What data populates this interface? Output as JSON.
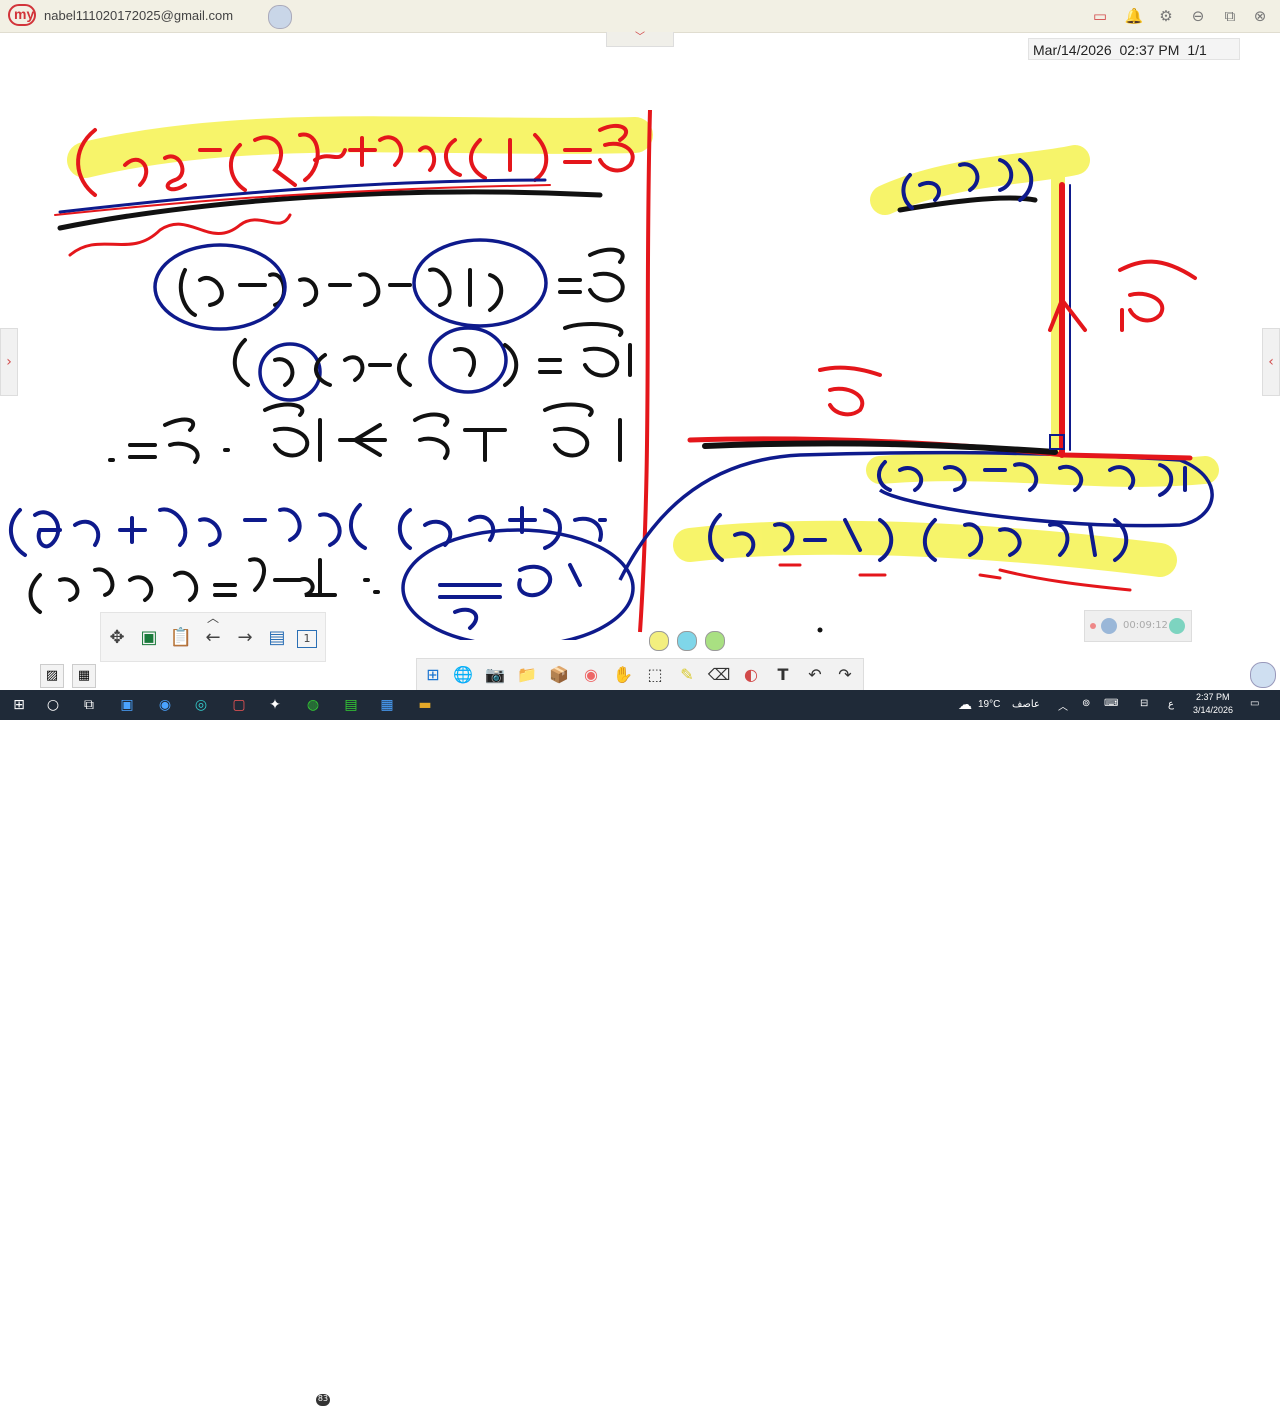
{
  "app": {
    "email": "nabel111020172025@gmail.com"
  },
  "topbar": {
    "icons": [
      "cast-icon",
      "bell-icon",
      "gear-icon",
      "minimize-icon",
      "restore-icon",
      "close-icon"
    ]
  },
  "header": {
    "date": "Mar/14/2026",
    "time": "02:37 PM",
    "page": "1/1"
  },
  "colors": {
    "ink_red": "#e4161b",
    "ink_blue": "#0e1a8c",
    "ink_black": "#111111",
    "highlight": "#f6f35a",
    "pen_yellow": "#f3ef7f",
    "pen_cyan": "#7fd6e9",
    "pen_green": "#a9e082"
  },
  "recorder": {
    "time": "00:09:12"
  },
  "pages_button": {
    "label": "1"
  },
  "taskbar": {
    "weather": "19°C",
    "weather_desc": "عاصف",
    "lang": "ع",
    "clock_time": "2:37 PM",
    "clock_date": "3/14/2026",
    "badge": "83"
  }
}
